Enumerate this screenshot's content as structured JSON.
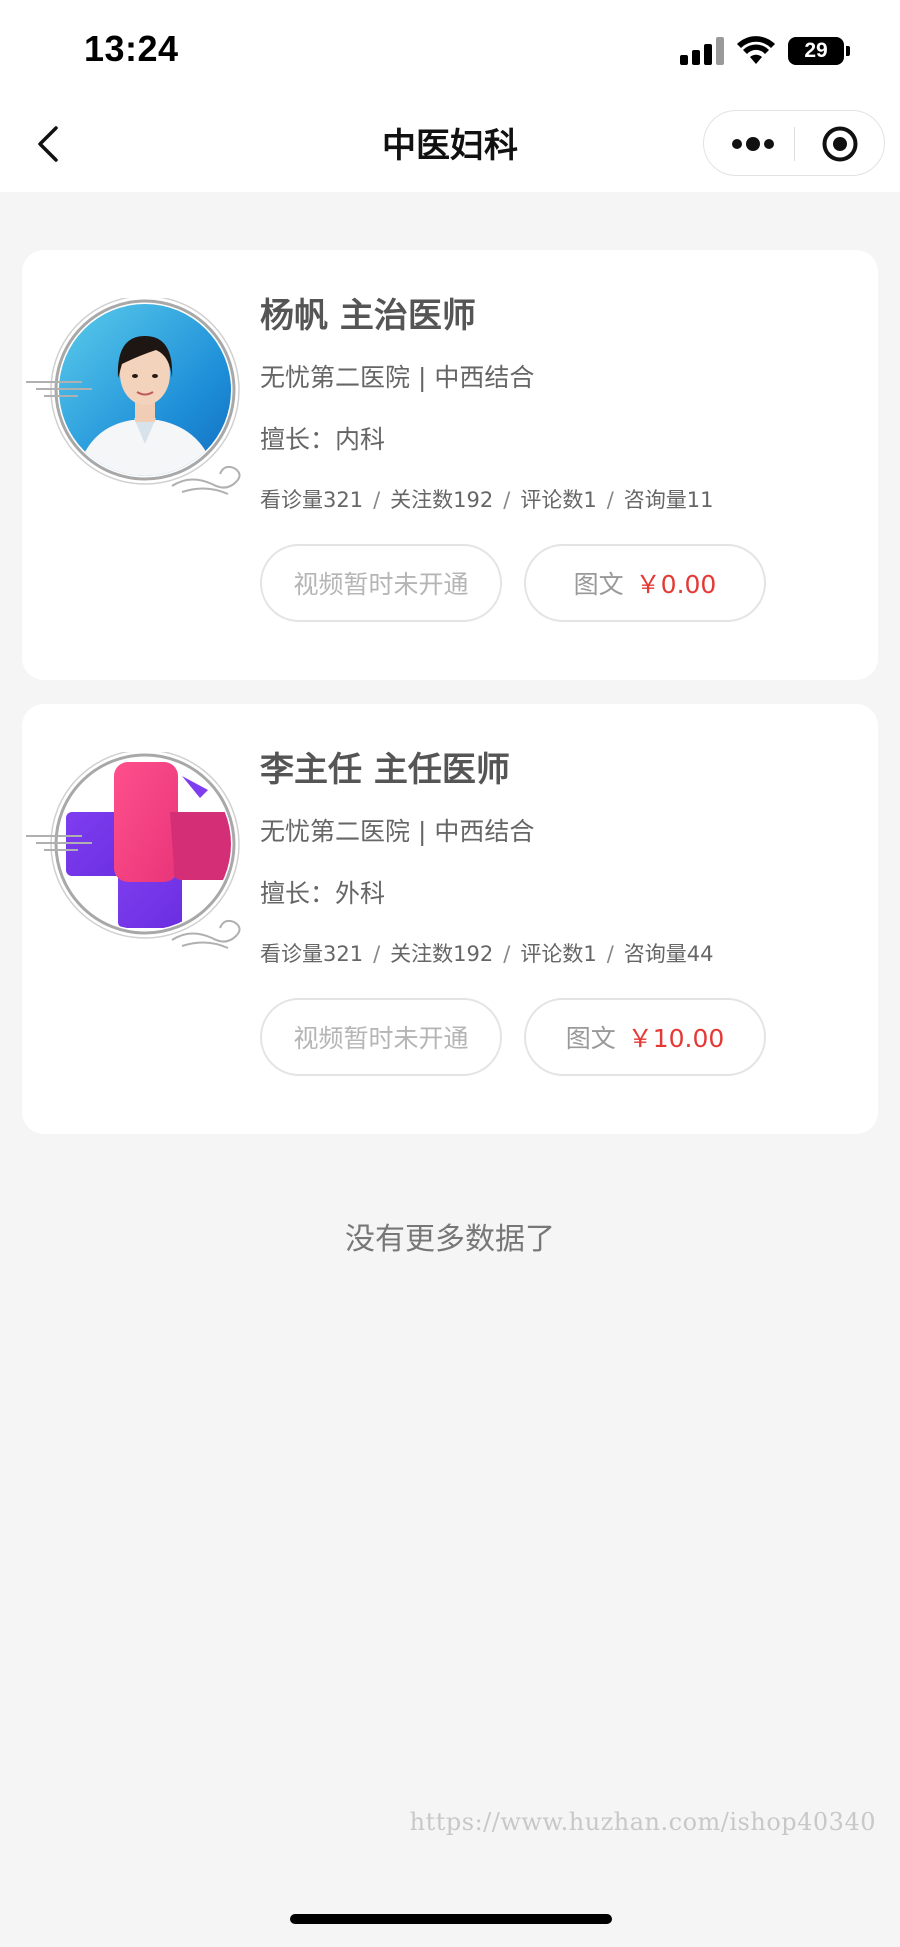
{
  "status_bar": {
    "time": "13:24",
    "battery": "29"
  },
  "nav": {
    "title": "中医妇科"
  },
  "doctors": [
    {
      "name": "杨帆 主治医师",
      "hospital": "无忧第二医院 | 中西结合",
      "specialty": "擅长：内科",
      "stats": {
        "visits": "看诊量321",
        "follows": "关注数192",
        "comments": "评论数1",
        "consults": "咨询量11"
      },
      "video_label": "视频暂时未开通",
      "text_label": "图文",
      "text_price": "￥0.00"
    },
    {
      "name": "李主任 主任医师",
      "hospital": "无忧第二医院 | 中西结合",
      "specialty": "擅长：外科",
      "stats": {
        "visits": "看诊量321",
        "follows": "关注数192",
        "comments": "评论数1",
        "consults": "咨询量44"
      },
      "video_label": "视频暂时未开通",
      "text_label": "图文",
      "text_price": "￥10.00"
    }
  ],
  "footer": {
    "no_more": "没有更多数据了"
  },
  "watermark": "https://www.huzhan.com/ishop40340",
  "colors": {
    "price": "#e53935",
    "background": "#f5f5f5",
    "card": "#ffffff"
  }
}
